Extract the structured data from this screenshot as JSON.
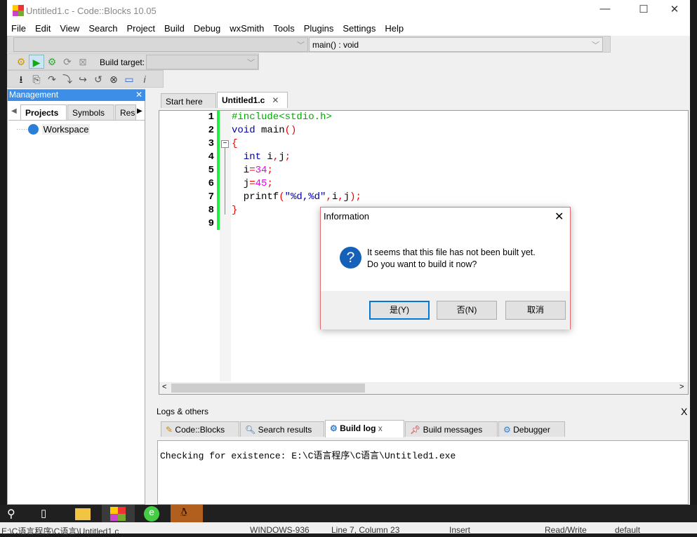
{
  "window": {
    "title": "Untitled1.c - Code::Blocks 10.05",
    "minimize": "—",
    "maximize": "☐",
    "close": "✕"
  },
  "menu": [
    "File",
    "Edit",
    "View",
    "Search",
    "Project",
    "Build",
    "Debug",
    "wxSmith",
    "Tools",
    "Plugins",
    "Settings",
    "Help"
  ],
  "toolbar": {
    "scope_combo": "",
    "function_combo": "main() : void",
    "build_target_label": "Build target:",
    "build_target_value": ""
  },
  "management": {
    "title": "Management",
    "tabs": [
      "Projects",
      "Symbols",
      "Res"
    ],
    "tree": [
      "Workspace"
    ]
  },
  "editor": {
    "tabs": [
      "Start here",
      "Untitled1.c"
    ],
    "active_tab": "Untitled1.c",
    "lines": [
      [
        [
          "#include<stdio.h>",
          "#0a0"
        ]
      ],
      [
        [
          "void ",
          "#00a"
        ],
        [
          "main",
          "#000"
        ],
        [
          "()",
          "#e00"
        ]
      ],
      [
        [
          "{",
          "#e00"
        ]
      ],
      [
        [
          "  ",
          ""
        ],
        [
          "int",
          "#00a"
        ],
        [
          " i",
          ""
        ],
        [
          ",",
          "#e00"
        ],
        [
          "j",
          ""
        ],
        [
          ";",
          "#e00"
        ]
      ],
      [
        [
          "  i",
          ""
        ],
        [
          "=",
          "#e00"
        ],
        [
          "34",
          "#e0e"
        ],
        [
          ";",
          "#e00"
        ]
      ],
      [
        [
          "  j",
          ""
        ],
        [
          "=",
          "#e00"
        ],
        [
          "45",
          "#e0e"
        ],
        [
          ";",
          "#e00"
        ]
      ],
      [
        [
          "  printf",
          ""
        ],
        [
          "(",
          "#e00"
        ],
        [
          "\"%d,%d\"",
          "#00a"
        ],
        [
          ",",
          "#e00"
        ],
        [
          "i",
          ""
        ],
        [
          ",",
          "#e00"
        ],
        [
          "j",
          ""
        ],
        [
          ");",
          "#e00"
        ]
      ],
      [
        [
          "}",
          "#e00"
        ]
      ],
      []
    ]
  },
  "logs": {
    "title": "Logs & others",
    "tabs": [
      "Code::Blocks",
      "Search results",
      "Build log",
      "Build messages",
      "Debugger"
    ],
    "active_tab": "Build log",
    "content": "Checking for existence: E:\\C语言程序\\C语言\\Untitled1.exe"
  },
  "dialog": {
    "title": "Information",
    "line1": "It seems that this file has not been built yet.",
    "line2": "Do you want to build it now?",
    "yes": "是(Y)",
    "no": "否(N)",
    "cancel": "取消",
    "close": "✕"
  },
  "status": {
    "file": "E:\\C语言程序\\C语言\\Untitled1.c",
    "encoding": "WINDOWS-936",
    "position": "Line 7, Column 23",
    "mode": "Insert",
    "access": "Read/Write",
    "lang": "default"
  }
}
